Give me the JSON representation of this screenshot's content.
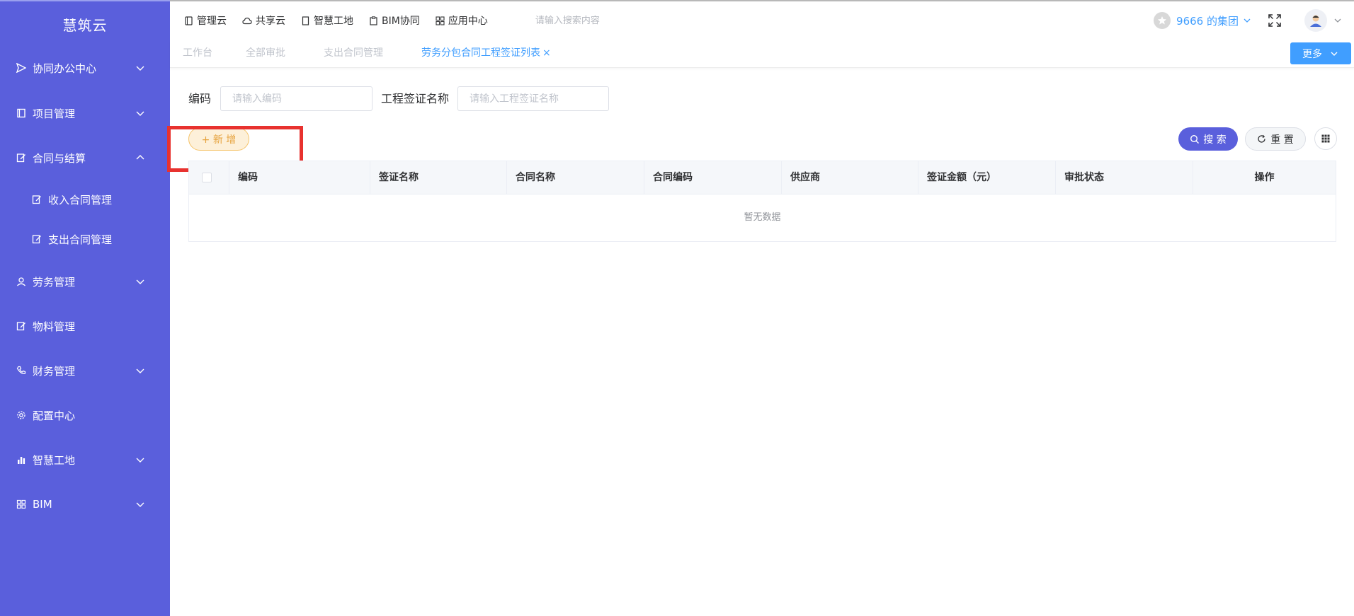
{
  "sidebar": {
    "logo": "慧筑云",
    "items": [
      {
        "label": "协同办公中心",
        "icon": "send-icon"
      },
      {
        "label": "项目管理",
        "icon": "book-icon"
      },
      {
        "label": "合同与结算",
        "icon": "edit-icon"
      },
      {
        "label": "收入合同管理",
        "icon": "edit-icon"
      },
      {
        "label": "支出合同管理",
        "icon": "edit-icon"
      },
      {
        "label": "劳务管理",
        "icon": "worker-icon"
      },
      {
        "label": "物料管理",
        "icon": "edit-icon"
      },
      {
        "label": "财务管理",
        "icon": "phone-icon"
      },
      {
        "label": "配置中心",
        "icon": "gear-icon"
      },
      {
        "label": "智慧工地",
        "icon": "bar-chart-icon"
      },
      {
        "label": "BIM",
        "icon": "grid-icon"
      }
    ]
  },
  "topnav": {
    "items": [
      {
        "label": "管理云",
        "icon": "tablet-icon"
      },
      {
        "label": "共享云",
        "icon": "cloud-icon"
      },
      {
        "label": "智慧工地",
        "icon": "doc-icon"
      },
      {
        "label": "BIM协同",
        "icon": "clipboard-icon"
      },
      {
        "label": "应用中心",
        "icon": "apps-icon"
      }
    ],
    "search_placeholder": "请输入搜索内容",
    "org_name": "9666 的集团"
  },
  "tabs": {
    "items": [
      "工作台",
      "全部审批",
      "支出合同管理",
      "劳务分包合同工程签证列表"
    ],
    "active_index": 3,
    "close_glyph": "×",
    "more_label": "更多"
  },
  "filters": {
    "code_label": "编码",
    "code_placeholder": "请输入编码",
    "name_label": "工程签证名称",
    "name_placeholder": "请输入工程签证名称"
  },
  "toolbar": {
    "add_label": "+ 新 增",
    "search_label": "搜 索",
    "reset_label": "重 置"
  },
  "table": {
    "columns": [
      "编码",
      "签证名称",
      "合同名称",
      "合同编码",
      "供应商",
      "签证金额（元）",
      "审批状态",
      "操作"
    ],
    "empty_text": "暂无数据"
  },
  "colors": {
    "sidebar_bg": "#5a5fdc",
    "primary": "#409eff",
    "accent": "#5a5fdc",
    "warning": "#e6a23c",
    "highlight": "#e8322f"
  }
}
